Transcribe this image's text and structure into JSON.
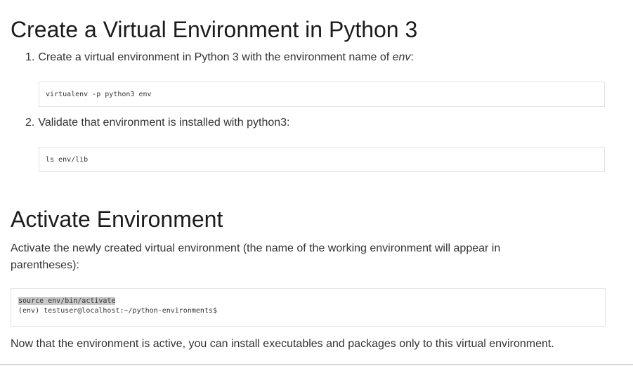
{
  "section1": {
    "title": "Create a Virtual Environment in Python 3",
    "steps": [
      {
        "number": "1.",
        "text_before": "Create a virtual environment in Python 3 with the environment name of ",
        "emphasis": "env",
        "text_after": ":",
        "code": "virtualenv -p python3 env"
      },
      {
        "number": "2.",
        "text": "Validate that environment is installed with python3:",
        "code": "ls env/lib"
      }
    ]
  },
  "section2": {
    "title": "Activate Environment",
    "intro": "Activate the newly created virtual environment (the name of the working environment will appear in parentheses):",
    "code_command": "source env/bin/activate",
    "code_output": "(env) testuser@localhost:~/python-environments$",
    "outro": "Now that the environment is active, you can install executables and packages only to this virtual environment."
  }
}
